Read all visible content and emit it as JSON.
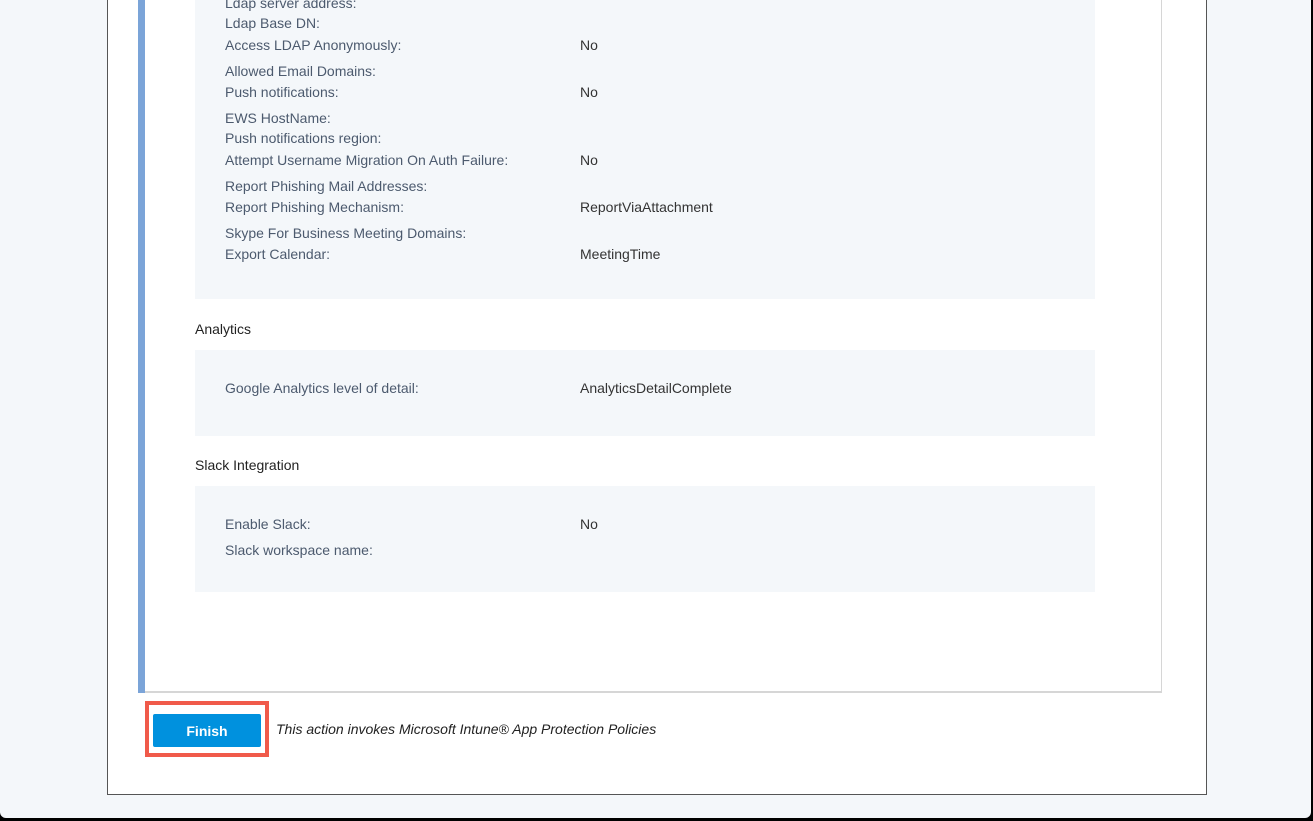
{
  "settings_section": {
    "rows": [
      {
        "label": "Ldap server address:",
        "value": ""
      },
      {
        "label": "Ldap Base DN:",
        "value": ""
      },
      {
        "label": "Access LDAP Anonymously:",
        "value": "No"
      },
      {
        "label": "Allowed Email Domains:",
        "value": ""
      },
      {
        "label": "Push notifications:",
        "value": "No"
      },
      {
        "label": "EWS HostName:",
        "value": ""
      },
      {
        "label": "Push notifications region:",
        "value": ""
      },
      {
        "label": "Attempt Username Migration On Auth Failure:",
        "value": "No"
      },
      {
        "label": "Report Phishing Mail Addresses:",
        "value": ""
      },
      {
        "label": "Report Phishing Mechanism:",
        "value": "ReportViaAttachment"
      },
      {
        "label": "Skype For Business Meeting Domains:",
        "value": ""
      },
      {
        "label": "Export Calendar:",
        "value": "MeetingTime"
      }
    ]
  },
  "analytics": {
    "heading": "Analytics",
    "rows": [
      {
        "label": "Google Analytics level of detail:",
        "value": "AnalyticsDetailComplete"
      }
    ]
  },
  "slack": {
    "heading": "Slack Integration",
    "rows": [
      {
        "label": "Enable Slack:",
        "value": "No"
      },
      {
        "label": "Slack workspace name:",
        "value": ""
      }
    ]
  },
  "footer": {
    "finish_label": "Finish",
    "note": "This action invokes Microsoft Intune® App Protection Policies"
  },
  "colors": {
    "accent": "#0091de",
    "highlight": "#f05a4a",
    "bar": "#7ba4d8"
  }
}
